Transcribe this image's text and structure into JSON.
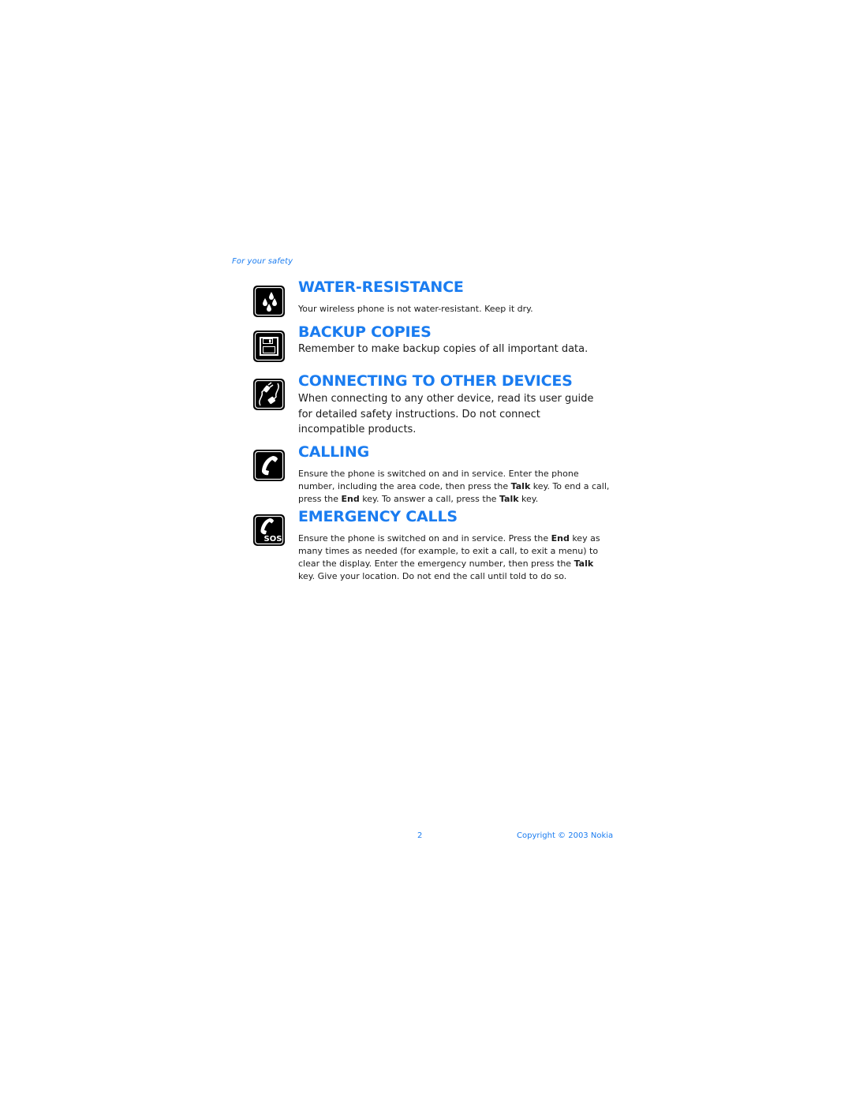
{
  "running_head": "For your safety",
  "colors": {
    "accent": "#1a7cf0",
    "text": "#1a1a1a",
    "icon": "#000000"
  },
  "sections": [
    {
      "icon": "water-drops-icon",
      "heading": "WATER-RESISTANCE",
      "body": "Your wireless phone is not water-resistant. Keep it dry."
    },
    {
      "icon": "floppy-disk-icon",
      "heading": "BACKUP COPIES",
      "body": "Remember to make backup copies of all important data."
    },
    {
      "icon": "plug-connector-icon",
      "heading": "CONNECTING TO OTHER DEVICES",
      "body": "When connecting to any other device, read its user guide for detailed safety instructions. Do not connect incompatible products."
    },
    {
      "icon": "phone-handset-icon",
      "heading": "CALLING",
      "body_parts": [
        "Ensure the phone is switched on and in service. Enter the phone number, including the area code, then press the ",
        "Talk",
        " key. To end a call, press the ",
        "End",
        " key. To answer a call, press the ",
        "Talk",
        " key."
      ]
    },
    {
      "icon": "sos-phone-icon",
      "heading": "EMERGENCY CALLS",
      "icon_label": "SOS",
      "body_parts": [
        "Ensure the phone is switched on and in service. Press the ",
        "End",
        " key as many times as needed (for example, to exit a call, to exit a menu) to clear the display. Enter the emergency number, then press the ",
        "Talk",
        " key. Give your location. Do not end the call until told to do so."
      ]
    }
  ],
  "footer": {
    "page_number": "2",
    "copyright": "Copyright © 2003 Nokia"
  }
}
